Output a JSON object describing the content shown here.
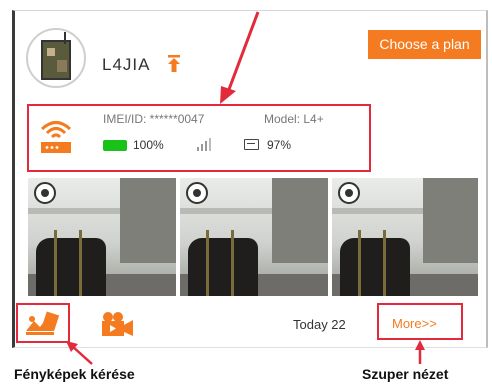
{
  "device": {
    "name": "L4JIA",
    "imei": "IMEI/ID: ******0047",
    "model": "Model: L4+",
    "battery": "100%",
    "storage": "97%"
  },
  "header": {
    "plan_button": "Choose a plan"
  },
  "footer": {
    "today": "Today 22",
    "more": "More>>"
  },
  "annotations": {
    "request_photos": "Fényképek kérése",
    "super_view": "Szuper nézet"
  },
  "photos": [
    {
      "id": "photo-1"
    },
    {
      "id": "photo-2"
    },
    {
      "id": "photo-3"
    }
  ],
  "colors": {
    "accent": "#f47b20",
    "highlight": "#e32a3c",
    "battery": "#19c219"
  }
}
